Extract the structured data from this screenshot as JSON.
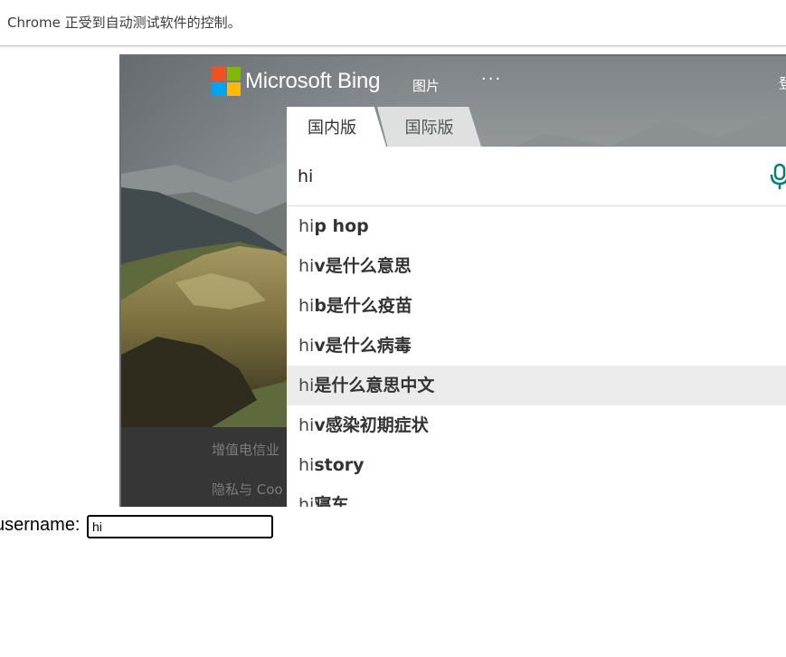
{
  "infobar": {
    "text": "Chrome 正受到自动测试软件的控制。"
  },
  "bing": {
    "logo_text": "Microsoft Bing",
    "nav_images": "图片",
    "nav_more": "···",
    "nav_login": "登",
    "tabs": [
      {
        "label": "国内版",
        "active": true
      },
      {
        "label": "国际版",
        "active": false
      }
    ],
    "search_value": "hi",
    "suggestions": [
      {
        "prefix": "hi",
        "suffix": "p hop"
      },
      {
        "prefix": "hi",
        "suffix": "v是什么意思"
      },
      {
        "prefix": "hi",
        "suffix": "b是什么疫苗"
      },
      {
        "prefix": "hi",
        "suffix": "v是什么病毒"
      },
      {
        "prefix": "hi",
        "suffix": "是什么意思中文",
        "highlighted": true
      },
      {
        "prefix": "hi",
        "suffix": "v感染初期症状"
      },
      {
        "prefix": "hi",
        "suffix": "story"
      },
      {
        "prefix": "hi",
        "suffix": "寝车"
      }
    ],
    "footer_lines": [
      "增值电信业",
      "隐私与 Coo"
    ],
    "colors": {
      "logo_red": "#f25022",
      "logo_green": "#7fba00",
      "logo_blue": "#00a4ef",
      "logo_yellow": "#ffb900",
      "mic": "#008373"
    }
  },
  "form": {
    "username_label": "username:",
    "username_value": "hi"
  }
}
